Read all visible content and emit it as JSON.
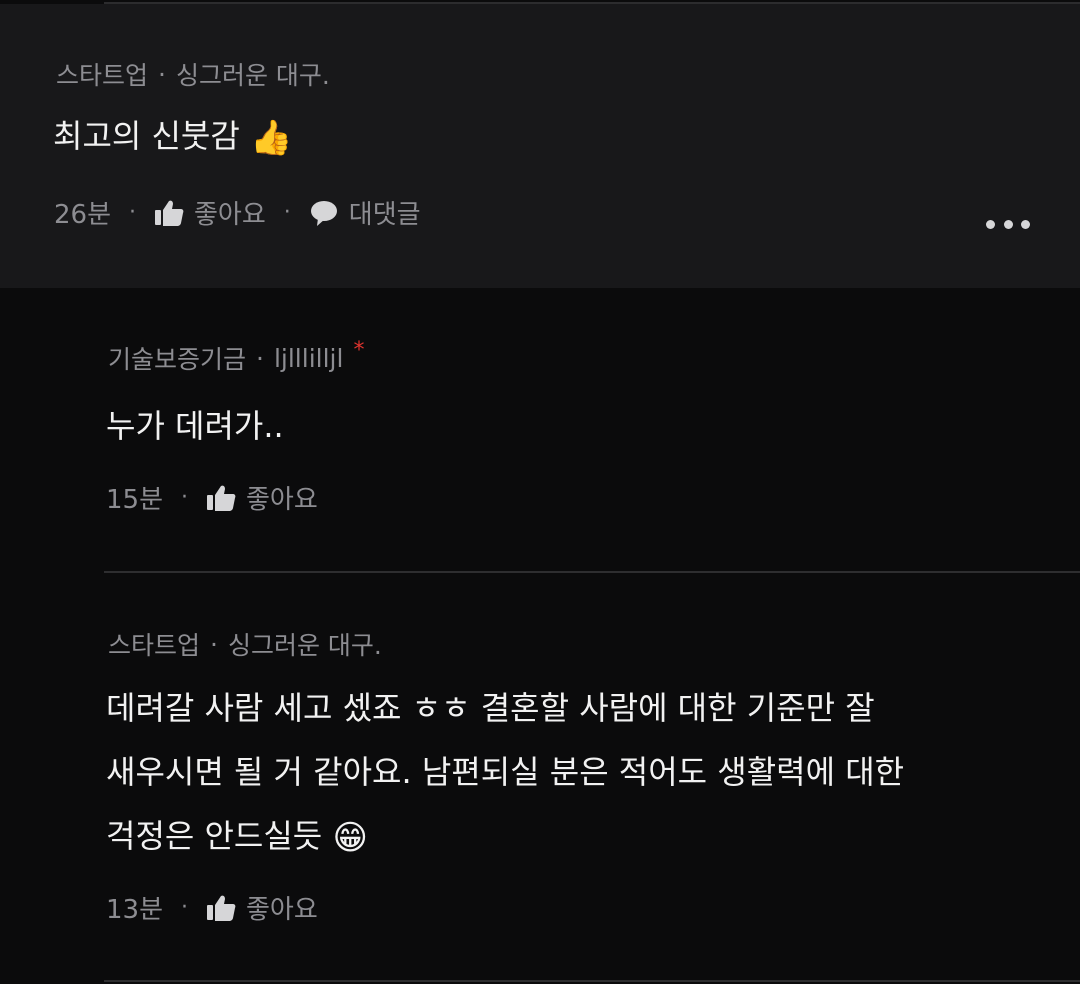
{
  "comments": [
    {
      "board": "스타트업",
      "separator": "·",
      "author": "싱그러운 대구.",
      "text": "최고의 신붓감",
      "emoji": "👍",
      "time": "26분",
      "like_label": "좋아요",
      "reply_label": "대댓글"
    },
    {
      "board": "기술보증기금",
      "separator": "·",
      "author": "ljlllilljl",
      "author_badge": "*",
      "text": "누가 데려가..",
      "time": "15분",
      "like_label": "좋아요"
    },
    {
      "board": "스타트업",
      "separator": "·",
      "author": "싱그러운 대구.",
      "text_lines": [
        "데려갈 사람 세고 셌죠 ㅎㅎ 결혼할 사람에 대한 기준만 잘",
        "새우시면 될 거 같아요. 남편되실 분은 적어도 생활력에 대한",
        "걱정은 안드실듯"
      ],
      "emoji": "😁",
      "time": "13분",
      "like_label": "좋아요"
    }
  ],
  "dot": "·",
  "colors": {
    "background": "#0b0b0c",
    "highlight_background": "#18181a",
    "meta_text": "#8d8d92",
    "body_text": "#f2f2f2",
    "badge": "#e0342f"
  },
  "icons": [
    "thumbs-up-icon",
    "speech-bubble-icon",
    "more-options-icon"
  ]
}
